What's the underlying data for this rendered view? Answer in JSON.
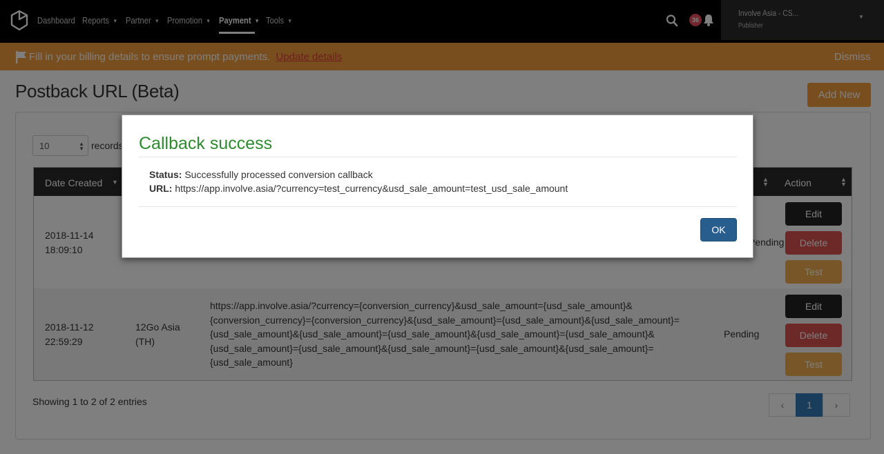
{
  "nav": {
    "logo_icon": "hexagon-logo-icon",
    "items": [
      {
        "label": "Dashboard",
        "has_caret": false
      },
      {
        "label": "Reports",
        "has_caret": true
      },
      {
        "label": "Partner",
        "has_caret": true
      },
      {
        "label": "Promotion",
        "has_caret": true
      },
      {
        "label": "Payment",
        "has_caret": true,
        "active": true
      },
      {
        "label": "Tools",
        "has_caret": true
      }
    ],
    "notification_count": "36",
    "user_name": "Involve Asia - CS...",
    "user_role": "Publisher"
  },
  "banner": {
    "text": "Fill in your billing details to ensure prompt payments.",
    "link": "Update details",
    "dismiss": "Dismiss",
    "color": "#f39c3f"
  },
  "page": {
    "title": "Postback URL (Beta)",
    "add_new": "Add New"
  },
  "table": {
    "length_value": "10",
    "records_label": "records",
    "headers": {
      "date": "Date Created",
      "action": "Action"
    },
    "rows": [
      {
        "date": "2018-11-14",
        "time": "18:09:10",
        "partner_line1": "",
        "partner_line2": "",
        "url_lines": [],
        "status": "Pending",
        "edit": "Edit",
        "delete": "Delete",
        "test": "Test"
      },
      {
        "date": "2018-11-12",
        "time": "22:59:29",
        "partner_line1": "12Go Asia",
        "partner_line2": "(TH)",
        "url_lines": [
          "https://app.involve.asia/?currency={conversion_currency}&usd_sale_amount={usd_sale_amount}&",
          "{conversion_currency}={conversion_currency}&{usd_sale_amount}={usd_sale_amount}&{usd_sale_amount}=",
          "{usd_sale_amount}&{usd_sale_amount}={usd_sale_amount}&{usd_sale_amount}={usd_sale_amount}&",
          "{usd_sale_amount}={usd_sale_amount}&{usd_sale_amount}={usd_sale_amount}&{usd_sale_amount}=",
          "{usd_sale_amount}"
        ],
        "status": "Pending",
        "edit": "Edit",
        "delete": "Delete",
        "test": "Test"
      }
    ],
    "showing": "Showing 1 to 2 of 2 entries",
    "pager": {
      "prev": "‹",
      "current": "1",
      "next": "›"
    }
  },
  "modal": {
    "title": "Callback success",
    "status_label": "Status:",
    "status_value": "Successfully processed conversion callback",
    "url_label": "URL:",
    "url_value": "https://app.involve.asia/?currency=test_currency&usd_sale_amount=test_usd_sale_amount",
    "ok": "OK",
    "title_color": "#2e8b2e"
  }
}
